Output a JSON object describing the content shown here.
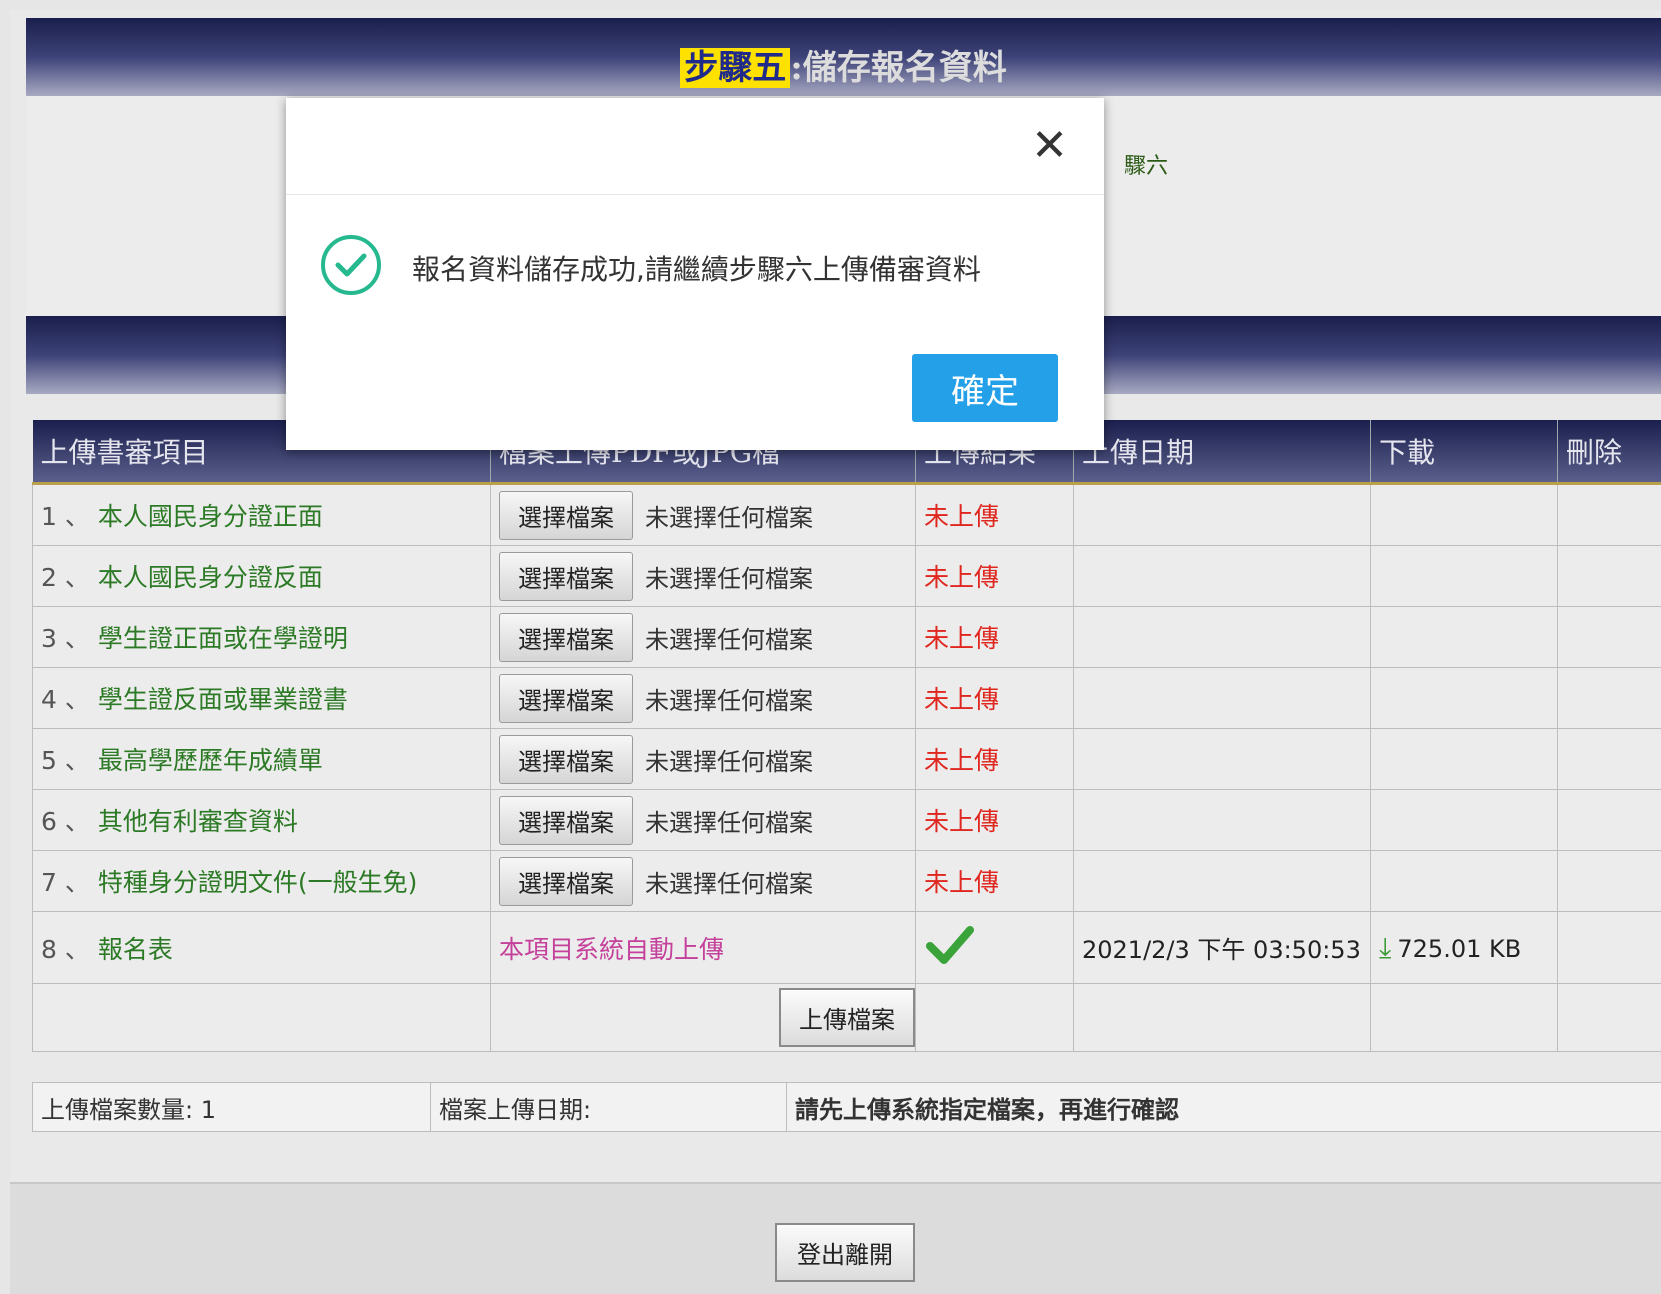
{
  "header": {
    "step_label": "步驟五",
    "step_title": ":儲存報名資料"
  },
  "info": {
    "partial_text": "驟六"
  },
  "table": {
    "columns": [
      "上傳書審項目",
      "檔案上傳PDF或JPG檔",
      "上傳結果",
      "上傳日期",
      "下載",
      "刪除"
    ],
    "choose_label": "選擇檔案",
    "no_file_label": "未選擇任何檔案",
    "not_uploaded": "未上傳",
    "rows": [
      {
        "num": "1 、",
        "name": "本人國民身分證正面"
      },
      {
        "num": "2 、",
        "name": "本人國民身分證反面"
      },
      {
        "num": "3 、",
        "name": "學生證正面或在學證明"
      },
      {
        "num": "4 、",
        "name": "學生證反面或畢業證書"
      },
      {
        "num": "5 、",
        "name": "最高學歷歷年成績單"
      },
      {
        "num": "6 、",
        "name": "其他有利審查資料"
      },
      {
        "num": "7 、",
        "name": "特種身分證明文件(一般生免)"
      }
    ],
    "auto_row": {
      "num": "8 、",
      "name": "報名表",
      "auto_text": "本項目系統自動上傳",
      "date": "2021/2/3 下午 03:50:53",
      "size": "725.01 KB"
    },
    "upload_button": "上傳檔案"
  },
  "summary": {
    "count": "上傳檔案數量: 1",
    "date_label": "檔案上傳日期:",
    "warning": "請先上傳系統指定檔案，再進行確認"
  },
  "logout_button": "登出離開",
  "modal": {
    "message": "報名資料儲存成功,請繼續步驟六上傳備審資料",
    "confirm": "確定"
  },
  "colors": {
    "confirm": "#23a0e8",
    "success": "#26b88f",
    "header": "#1b1f4d"
  }
}
